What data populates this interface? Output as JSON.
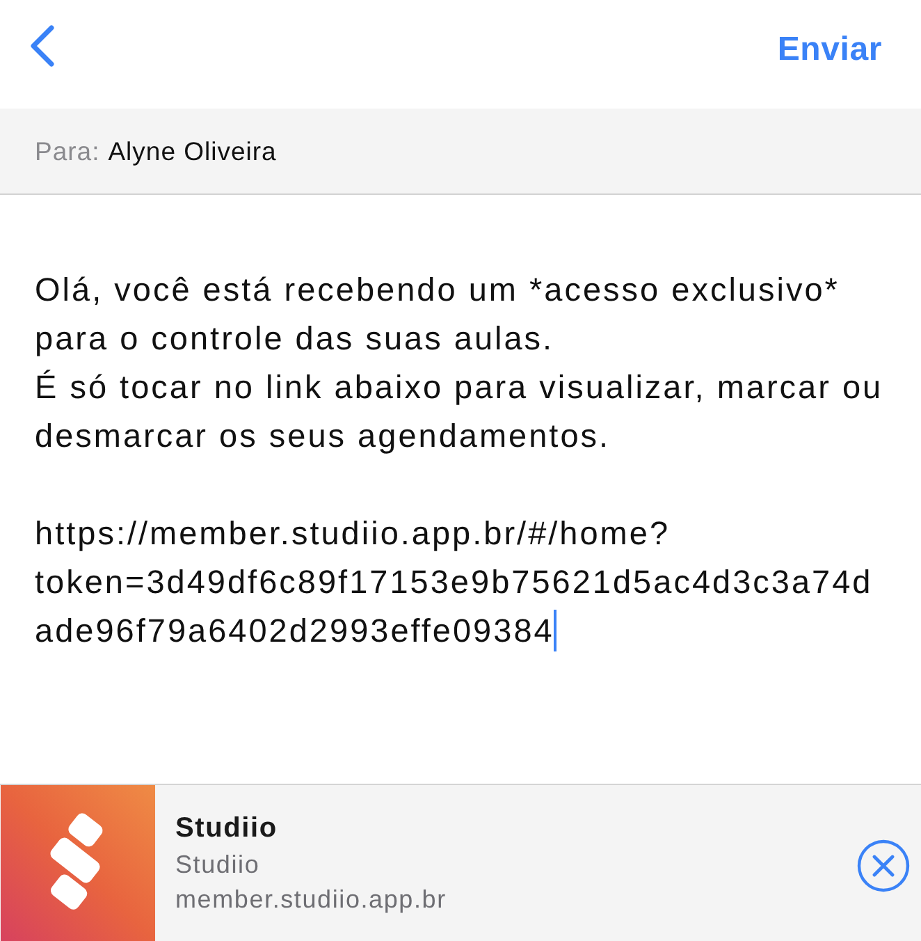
{
  "nav": {
    "send_button": "Enviar"
  },
  "recipient": {
    "label": "Para:",
    "name": "Alyne Oliveira"
  },
  "message": {
    "paragraphs": [
      "Olá, você está recebendo um *acesso exclusivo* para o controle das suas aulas.\nÉ só tocar no link abaixo para visualizar, marcar ou desmarcar os seus agendamentos.",
      "https://member.studiio.app.br/#/home?token=3d49df6c89f17153e9b75621d5ac4d3c3a74dade96f79a6402d2993effe09384"
    ],
    "focused": true
  },
  "app_banner": {
    "title": "Studiio",
    "subtitle": "Studiio",
    "url": "member.studiio.app.br"
  }
}
